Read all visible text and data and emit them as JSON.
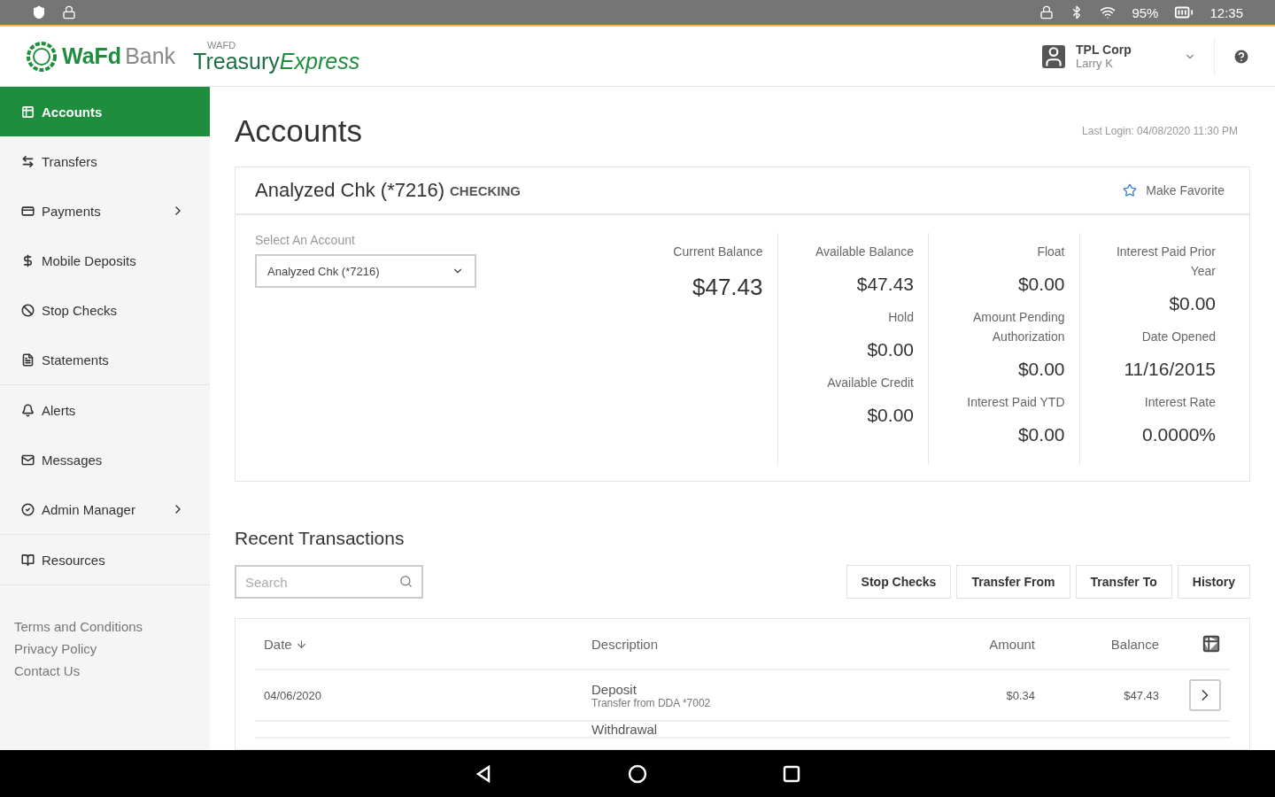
{
  "status_bar": {
    "battery": "95%",
    "time": "12:35"
  },
  "header": {
    "bank_name_bold": "WaFd",
    "bank_name_light": "Bank",
    "product_small": "WAFD",
    "product_plain": "Treasury",
    "product_italic": "Express",
    "company": "TPL Corp",
    "user": "Larry K"
  },
  "sidebar": {
    "groups": [
      [
        {
          "label": "Accounts",
          "selected": true,
          "has_submenu": false
        },
        {
          "label": "Transfers",
          "selected": false,
          "has_submenu": false
        },
        {
          "label": "Payments",
          "selected": false,
          "has_submenu": true
        },
        {
          "label": "Mobile Deposits",
          "selected": false,
          "has_submenu": false
        },
        {
          "label": "Stop Checks",
          "selected": false,
          "has_submenu": false
        },
        {
          "label": "Statements",
          "selected": false,
          "has_submenu": false
        }
      ],
      [
        {
          "label": "Alerts",
          "selected": false,
          "has_submenu": false
        },
        {
          "label": "Messages",
          "selected": false,
          "has_submenu": false
        },
        {
          "label": "Admin Manager",
          "selected": false,
          "has_submenu": true
        }
      ],
      [
        {
          "label": "Resources",
          "selected": false,
          "has_submenu": false
        }
      ]
    ],
    "footer_links": [
      "Terms and Conditions",
      "Privacy Policy",
      "Contact Us"
    ]
  },
  "page": {
    "title": "Accounts",
    "last_login": "Last Login: 04/08/2020 11:30 PM"
  },
  "account": {
    "name": "Analyzed Chk (*7216)",
    "type": "CHECKING",
    "favorite_label": "Make Favorite",
    "favorite": false,
    "select_label": "Select An Account",
    "select_value": "Analyzed Chk (*7216)",
    "columns": [
      [
        {
          "label": "Current Balance",
          "value": "$47.43"
        }
      ],
      [
        {
          "label": "Available Balance",
          "value": "$47.43"
        },
        {
          "label": "Hold",
          "value": "$0.00"
        },
        {
          "label": "Available Credit",
          "value": "$0.00"
        }
      ],
      [
        {
          "label": "Float",
          "value": "$0.00"
        },
        {
          "label": "Amount Pending Authorization",
          "value": "$0.00"
        },
        {
          "label": "Interest Paid YTD",
          "value": "$0.00"
        }
      ],
      [
        {
          "label": "Interest Paid Prior Year",
          "value": "$0.00"
        },
        {
          "label": "Date Opened",
          "value": "11/16/2015"
        },
        {
          "label": "Interest Rate",
          "value": "0.0000%"
        }
      ]
    ]
  },
  "transactions": {
    "title": "Recent Transactions",
    "search": {
      "placeholder": "Search"
    },
    "buttons": [
      "Stop Checks",
      "Transfer From",
      "Transfer To",
      "History"
    ],
    "columns": [
      "Date",
      "Description",
      "Amount",
      "Balance"
    ],
    "rows": [
      {
        "date": "04/06/2020",
        "description": "Deposit",
        "detail": "Transfer from DDA *7002",
        "amount": "$0.34",
        "balance": "$47.43"
      },
      {
        "description": "Withdrawal"
      }
    ]
  }
}
